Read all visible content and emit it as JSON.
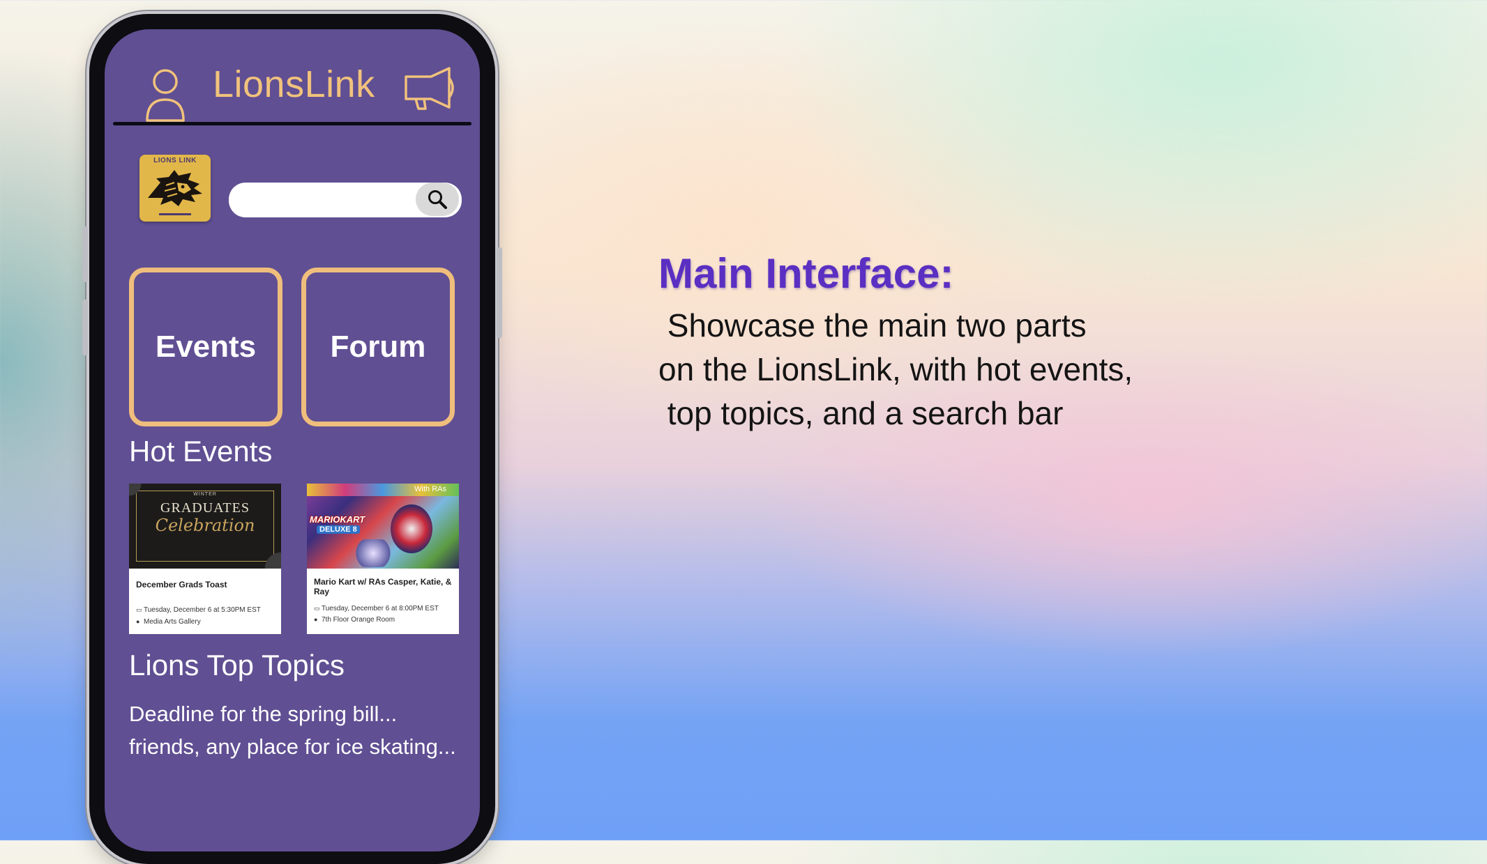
{
  "app": {
    "title": "LionsLink",
    "logo_text": "LIONS LINK"
  },
  "search": {
    "placeholder": ""
  },
  "tiles": {
    "events_label": "Events",
    "forum_label": "Forum"
  },
  "hot_events": {
    "title": "Hot Events",
    "cards": [
      {
        "image_caption_top": "WINTER",
        "image_caption_main": "GRADUATES",
        "image_caption_script": "Celebration",
        "title": "December Grads Toast",
        "date": "Tuesday, December 6 at 5:30PM EST",
        "location": "Media Arts Gallery"
      },
      {
        "image_caption_top": "With RAs",
        "image_caption_main": "MARIOKART",
        "image_caption_script": "DELUXE 8",
        "title": "Mario Kart w/ RAs Casper, Katie, & Ray",
        "date": "Tuesday, December 6 at 8:00PM EST",
        "location": "7th Floor Orange Room"
      }
    ]
  },
  "top_topics": {
    "title": "Lions Top Topics",
    "items": [
      "Deadline for the spring bill...",
      "friends, any place for ice skating..."
    ]
  },
  "slide": {
    "heading": "Main Interface:",
    "lines": [
      " Showcase the main two parts",
      "on the LionsLink, with hot events,",
      " top topics, and a search bar"
    ]
  },
  "colors": {
    "screen_bg": "#604f93",
    "accent_gold": "#f0be7c",
    "heading_purple": "#5a2fc2"
  },
  "icons": [
    "user-icon",
    "megaphone-icon",
    "search-icon",
    "calendar-icon",
    "location-pin-icon"
  ]
}
